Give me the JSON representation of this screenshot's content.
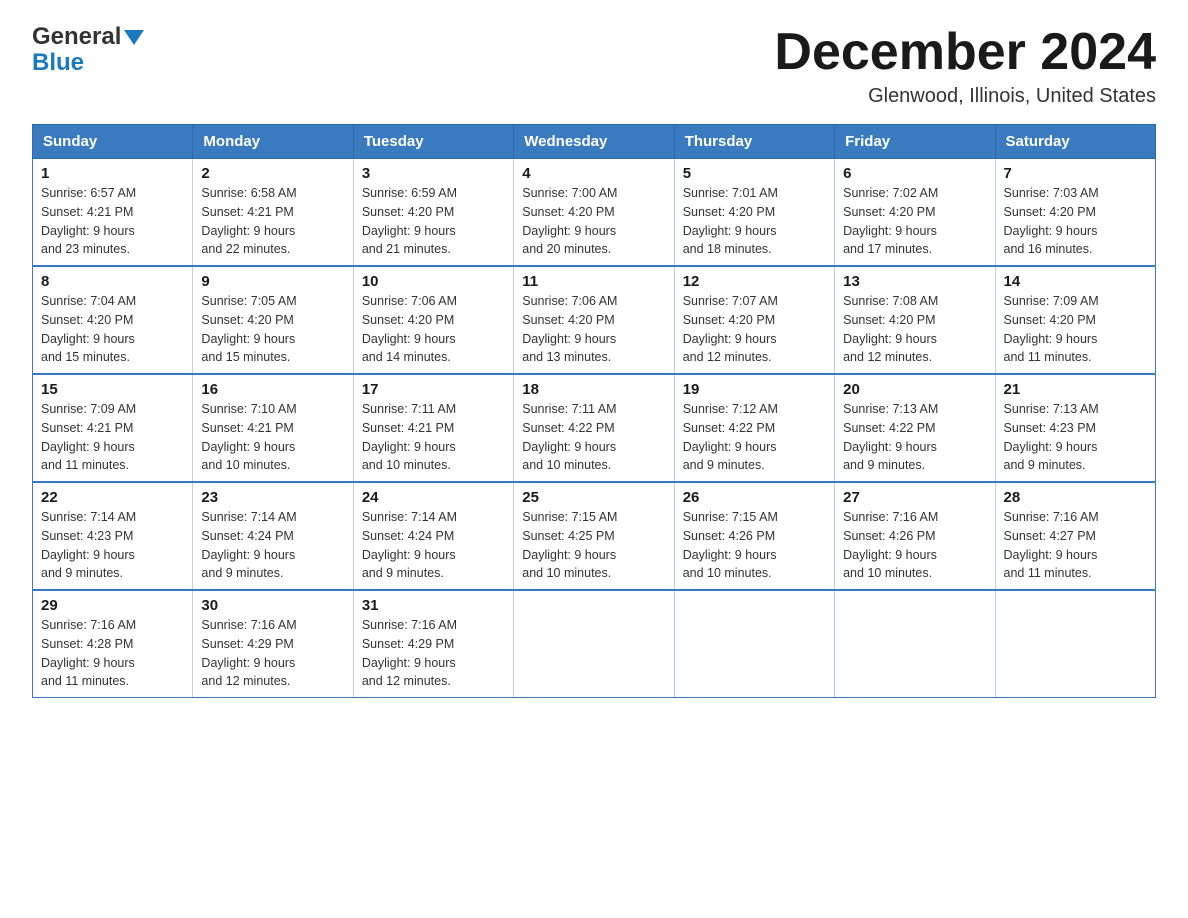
{
  "header": {
    "title": "December 2024",
    "subtitle": "Glenwood, Illinois, United States",
    "logo_general": "General",
    "logo_blue": "Blue"
  },
  "days_of_week": [
    "Sunday",
    "Monday",
    "Tuesday",
    "Wednesday",
    "Thursday",
    "Friday",
    "Saturday"
  ],
  "weeks": [
    [
      {
        "day": "1",
        "sunrise": "6:57 AM",
        "sunset": "4:21 PM",
        "daylight": "9 hours and 23 minutes."
      },
      {
        "day": "2",
        "sunrise": "6:58 AM",
        "sunset": "4:21 PM",
        "daylight": "9 hours and 22 minutes."
      },
      {
        "day": "3",
        "sunrise": "6:59 AM",
        "sunset": "4:20 PM",
        "daylight": "9 hours and 21 minutes."
      },
      {
        "day": "4",
        "sunrise": "7:00 AM",
        "sunset": "4:20 PM",
        "daylight": "9 hours and 20 minutes."
      },
      {
        "day": "5",
        "sunrise": "7:01 AM",
        "sunset": "4:20 PM",
        "daylight": "9 hours and 18 minutes."
      },
      {
        "day": "6",
        "sunrise": "7:02 AM",
        "sunset": "4:20 PM",
        "daylight": "9 hours and 17 minutes."
      },
      {
        "day": "7",
        "sunrise": "7:03 AM",
        "sunset": "4:20 PM",
        "daylight": "9 hours and 16 minutes."
      }
    ],
    [
      {
        "day": "8",
        "sunrise": "7:04 AM",
        "sunset": "4:20 PM",
        "daylight": "9 hours and 15 minutes."
      },
      {
        "day": "9",
        "sunrise": "7:05 AM",
        "sunset": "4:20 PM",
        "daylight": "9 hours and 15 minutes."
      },
      {
        "day": "10",
        "sunrise": "7:06 AM",
        "sunset": "4:20 PM",
        "daylight": "9 hours and 14 minutes."
      },
      {
        "day": "11",
        "sunrise": "7:06 AM",
        "sunset": "4:20 PM",
        "daylight": "9 hours and 13 minutes."
      },
      {
        "day": "12",
        "sunrise": "7:07 AM",
        "sunset": "4:20 PM",
        "daylight": "9 hours and 12 minutes."
      },
      {
        "day": "13",
        "sunrise": "7:08 AM",
        "sunset": "4:20 PM",
        "daylight": "9 hours and 12 minutes."
      },
      {
        "day": "14",
        "sunrise": "7:09 AM",
        "sunset": "4:20 PM",
        "daylight": "9 hours and 11 minutes."
      }
    ],
    [
      {
        "day": "15",
        "sunrise": "7:09 AM",
        "sunset": "4:21 PM",
        "daylight": "9 hours and 11 minutes."
      },
      {
        "day": "16",
        "sunrise": "7:10 AM",
        "sunset": "4:21 PM",
        "daylight": "9 hours and 10 minutes."
      },
      {
        "day": "17",
        "sunrise": "7:11 AM",
        "sunset": "4:21 PM",
        "daylight": "9 hours and 10 minutes."
      },
      {
        "day": "18",
        "sunrise": "7:11 AM",
        "sunset": "4:22 PM",
        "daylight": "9 hours and 10 minutes."
      },
      {
        "day": "19",
        "sunrise": "7:12 AM",
        "sunset": "4:22 PM",
        "daylight": "9 hours and 9 minutes."
      },
      {
        "day": "20",
        "sunrise": "7:13 AM",
        "sunset": "4:22 PM",
        "daylight": "9 hours and 9 minutes."
      },
      {
        "day": "21",
        "sunrise": "7:13 AM",
        "sunset": "4:23 PM",
        "daylight": "9 hours and 9 minutes."
      }
    ],
    [
      {
        "day": "22",
        "sunrise": "7:14 AM",
        "sunset": "4:23 PM",
        "daylight": "9 hours and 9 minutes."
      },
      {
        "day": "23",
        "sunrise": "7:14 AM",
        "sunset": "4:24 PM",
        "daylight": "9 hours and 9 minutes."
      },
      {
        "day": "24",
        "sunrise": "7:14 AM",
        "sunset": "4:24 PM",
        "daylight": "9 hours and 9 minutes."
      },
      {
        "day": "25",
        "sunrise": "7:15 AM",
        "sunset": "4:25 PM",
        "daylight": "9 hours and 10 minutes."
      },
      {
        "day": "26",
        "sunrise": "7:15 AM",
        "sunset": "4:26 PM",
        "daylight": "9 hours and 10 minutes."
      },
      {
        "day": "27",
        "sunrise": "7:16 AM",
        "sunset": "4:26 PM",
        "daylight": "9 hours and 10 minutes."
      },
      {
        "day": "28",
        "sunrise": "7:16 AM",
        "sunset": "4:27 PM",
        "daylight": "9 hours and 11 minutes."
      }
    ],
    [
      {
        "day": "29",
        "sunrise": "7:16 AM",
        "sunset": "4:28 PM",
        "daylight": "9 hours and 11 minutes."
      },
      {
        "day": "30",
        "sunrise": "7:16 AM",
        "sunset": "4:29 PM",
        "daylight": "9 hours and 12 minutes."
      },
      {
        "day": "31",
        "sunrise": "7:16 AM",
        "sunset": "4:29 PM",
        "daylight": "9 hours and 12 minutes."
      },
      null,
      null,
      null,
      null
    ]
  ],
  "labels": {
    "sunrise": "Sunrise:",
    "sunset": "Sunset:",
    "daylight": "Daylight:"
  }
}
